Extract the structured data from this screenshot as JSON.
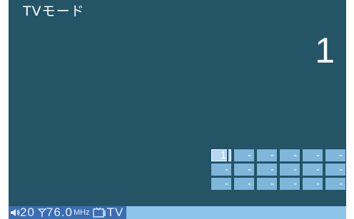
{
  "header": {
    "title": "TVモード"
  },
  "channel": {
    "current": "1"
  },
  "presets": [
    {
      "label": "1",
      "active": true
    },
    {
      "label": "-",
      "active": false
    },
    {
      "label": "-",
      "active": false
    },
    {
      "label": "-",
      "active": false
    },
    {
      "label": "-",
      "active": false
    },
    {
      "label": "-",
      "active": false
    },
    {
      "label": "-",
      "active": false
    },
    {
      "label": "-",
      "active": false
    },
    {
      "label": "-",
      "active": false
    },
    {
      "label": "-",
      "active": false
    },
    {
      "label": "-",
      "active": false
    },
    {
      "label": "-",
      "active": false
    },
    {
      "label": "-",
      "active": false
    },
    {
      "label": "-",
      "active": false
    },
    {
      "label": "-",
      "active": false
    },
    {
      "label": "-",
      "active": false
    },
    {
      "label": "-",
      "active": false
    },
    {
      "label": "-",
      "active": false
    }
  ],
  "status": {
    "volume": "20",
    "frequency": "76.0",
    "frequency_unit": "MHz",
    "source": "TV",
    "icons": {
      "volume": "speaker-icon",
      "antenna": "antenna-icon",
      "input": "tv-input-icon"
    }
  },
  "colors": {
    "background": "#235567",
    "preset": "#7fb6da",
    "status_bar": "#8cc4eb",
    "status_track": "#3b6db2"
  }
}
